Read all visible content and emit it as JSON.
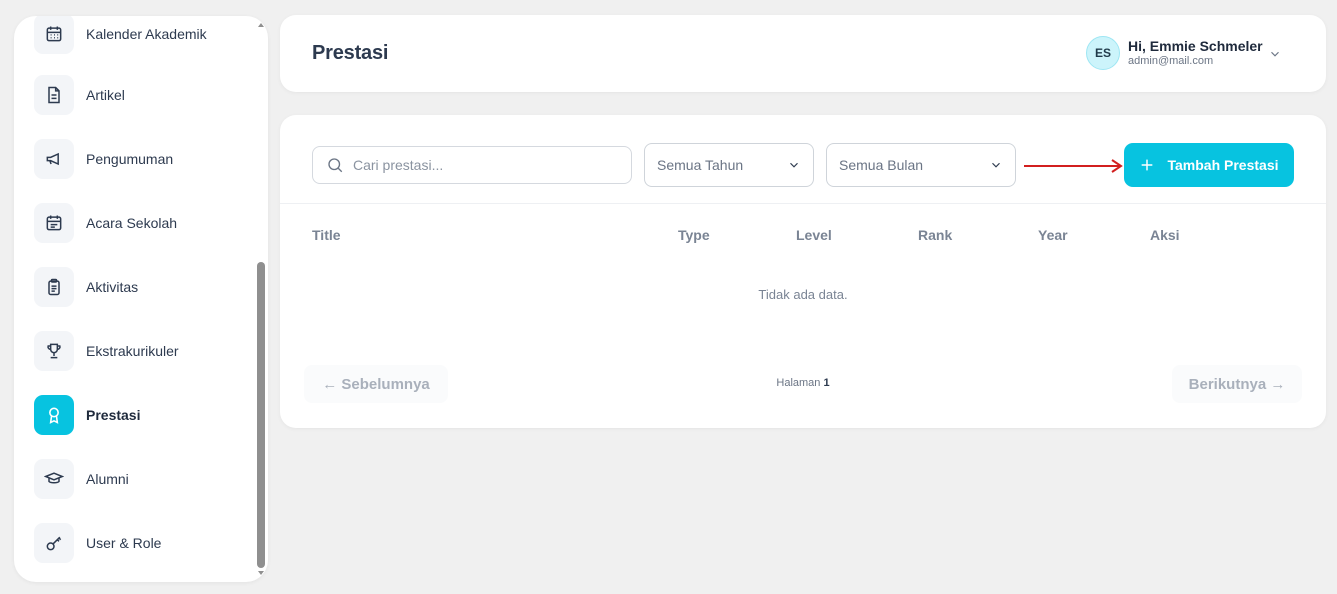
{
  "sidebar": {
    "items": [
      {
        "label": "Kalender Akademik",
        "icon": "calendar-icon",
        "active": false
      },
      {
        "label": "Artikel",
        "icon": "document-icon",
        "active": false
      },
      {
        "label": "Pengumuman",
        "icon": "megaphone-icon",
        "active": false
      },
      {
        "label": "Acara Sekolah",
        "icon": "calendar-event-icon",
        "active": false
      },
      {
        "label": "Aktivitas",
        "icon": "clipboard-icon",
        "active": false
      },
      {
        "label": "Ekstrakurikuler",
        "icon": "trophy-icon",
        "active": false
      },
      {
        "label": "Prestasi",
        "icon": "award-icon",
        "active": true
      },
      {
        "label": "Alumni",
        "icon": "graduation-cap-icon",
        "active": false
      },
      {
        "label": "User & Role",
        "icon": "key-icon",
        "active": false
      }
    ]
  },
  "header": {
    "title": "Prestasi",
    "user": {
      "initials": "ES",
      "greeting": "Hi, Emmie Schmeler",
      "email": "admin@mail.com"
    }
  },
  "toolbar": {
    "search_placeholder": "Cari prestasi...",
    "year_filter": "Semua Tahun",
    "month_filter": "Semua Bulan",
    "add_label": "Tambah Prestasi"
  },
  "table": {
    "columns": [
      "Title",
      "Type",
      "Level",
      "Rank",
      "Year",
      "Aksi"
    ],
    "empty_message": "Tidak ada data."
  },
  "pagination": {
    "prev_label": "← Sebelumnya",
    "page_prefix": "Halaman",
    "page_number": "1",
    "next_label": "Berikutnya →"
  },
  "colors": {
    "accent": "#07c3e0",
    "annotation_arrow": "#d21f1f"
  }
}
